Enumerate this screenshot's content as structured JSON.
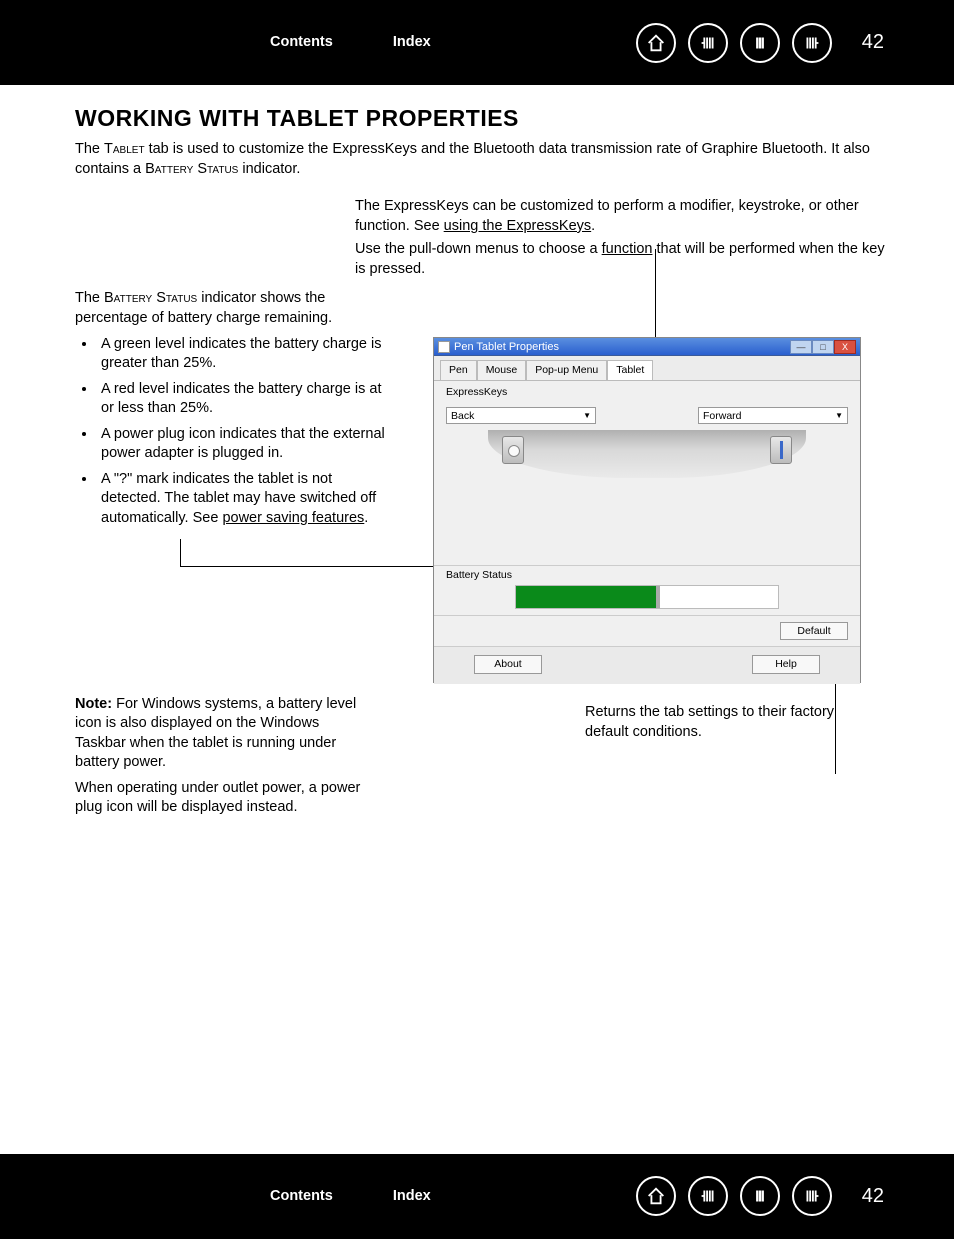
{
  "nav": {
    "contents": "Contents",
    "index": "Index",
    "page": "42"
  },
  "heading": "WORKING WITH TABLET PROPERTIES",
  "intro": {
    "pre": "The ",
    "sc1": "Tablet",
    "mid": " tab is used to customize the ExpressKeys and the Bluetooth data transmission rate of Graphire Bluetooth.  It also contains a ",
    "sc2": "Battery Status",
    "post": " indicator."
  },
  "topright": {
    "p1a": "The ExpressKeys can be customized to perform a modifier, keystroke, or other function.  See ",
    "p1link": "using the ExpressKeys",
    "p1b": ".",
    "p2a": "Use the pull-down menus to choose a ",
    "p2link": "function",
    "p2b": " that will be performed when the key is pressed."
  },
  "leftcol": {
    "p_pre": "The ",
    "p_sc": "Battery Status",
    "p_post": " indicator shows the percentage of battery charge remaining.",
    "li1": "A green level indicates the battery charge is greater than 25%.",
    "li2": "A red level indicates the battery charge is at or less than 25%.",
    "li3": "A power plug icon indicates that the external power adapter is plugged in.",
    "li4a": "A \"?\" mark indicates the tablet is not detected.  The tablet may have switched off automatically.  See ",
    "li4link": "power saving features",
    "li4b": "."
  },
  "app": {
    "title": "Pen Tablet Properties",
    "tabs": {
      "pen": "Pen",
      "mouse": "Mouse",
      "popup": "Pop-up Menu",
      "tablet": "Tablet"
    },
    "express_label": "ExpressKeys",
    "back": "Back",
    "forward": "Forward",
    "battery_label": "Battery Status",
    "default_btn": "Default",
    "about_btn": "About",
    "help_btn": "Help",
    "min": "—",
    "max": "□",
    "close": "X"
  },
  "note": {
    "label": "Note:",
    "p1": " For Windows systems, a battery level icon is also displayed on the Windows Taskbar when the tablet is running under battery power.",
    "p2": "When operating under outlet power, a power plug icon will be displayed instead."
  },
  "default_caption": "Returns the tab settings to their factory default conditions."
}
